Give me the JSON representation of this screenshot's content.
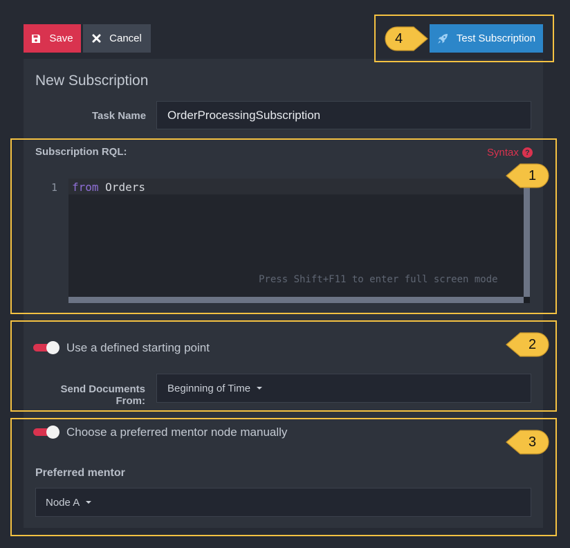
{
  "toolbar": {
    "save_label": "Save",
    "cancel_label": "Cancel",
    "test_label": "Test Subscription"
  },
  "form": {
    "title": "New Subscription",
    "task_name_label": "Task Name",
    "task_name_value": "OrderProcessingSubscription",
    "rql_label": "Subscription RQL:",
    "syntax_label": "Syntax",
    "editor": {
      "line_number": "1",
      "keyword": "from",
      "collection": "Orders",
      "hint": "Press Shift+F11 to enter full screen mode"
    },
    "starting_point_label": "Use a defined starting point",
    "send_docs_label_line1": "Send Documents",
    "send_docs_label_line2": "From:",
    "send_docs_value": "Beginning of Time",
    "mentor_toggle_label": "Choose a preferred mentor node manually",
    "preferred_mentor_label": "Preferred mentor",
    "preferred_mentor_value": "Node A"
  },
  "callouts": [
    "1",
    "2",
    "3",
    "4"
  ],
  "colors": {
    "accent_red": "#d9334f",
    "accent_blue": "#2c86c9",
    "highlight_yellow": "#f5c242",
    "keyword_purple": "#8f6fd6"
  }
}
